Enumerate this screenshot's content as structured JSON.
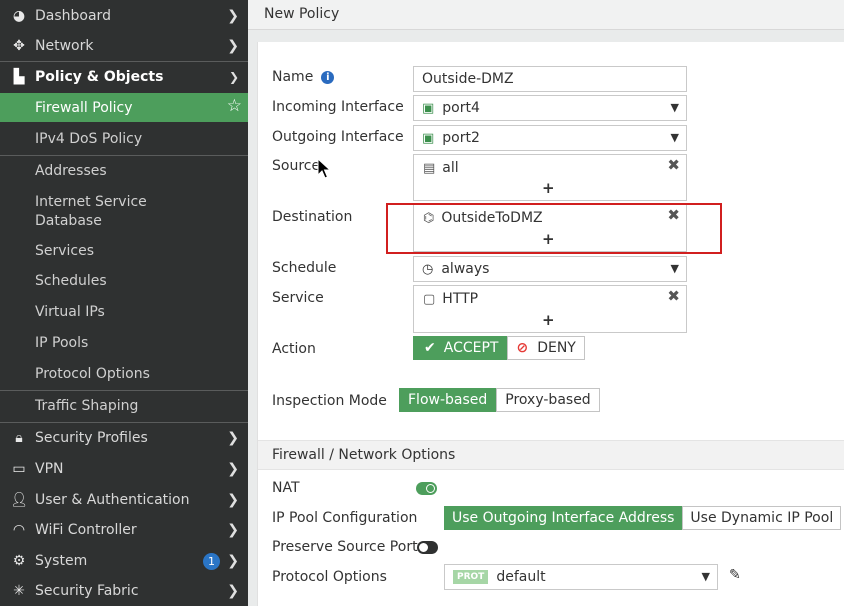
{
  "sidebar": {
    "items": [
      {
        "label": "Dashboard",
        "icon": "dashboard-icon"
      },
      {
        "label": "Network",
        "icon": "network-icon"
      },
      {
        "label": "Policy & Objects",
        "icon": "policy-icon"
      },
      {
        "label": "Security Profiles",
        "icon": "lock-icon"
      },
      {
        "label": "VPN",
        "icon": "laptop-icon"
      },
      {
        "label": "User & Authentication",
        "icon": "user-icon"
      },
      {
        "label": "WiFi Controller",
        "icon": "wifi-icon"
      },
      {
        "label": "System",
        "icon": "gear-icon",
        "badge": "1"
      },
      {
        "label": "Security Fabric",
        "icon": "fabric-icon"
      }
    ],
    "policy_sub": [
      {
        "label": "Firewall Policy",
        "active": true
      },
      {
        "label": "IPv4 DoS Policy"
      },
      {
        "label": "Addresses"
      },
      {
        "label": "Internet Service",
        "label2": "Database"
      },
      {
        "label": "Services"
      },
      {
        "label": "Schedules"
      },
      {
        "label": "Virtual IPs"
      },
      {
        "label": "IP Pools"
      },
      {
        "label": "Protocol Options"
      },
      {
        "label": "Traffic Shaping"
      }
    ]
  },
  "page": {
    "title": "New Policy"
  },
  "form": {
    "name_label": "Name",
    "name_value": "Outside-DMZ",
    "incoming_label": "Incoming Interface",
    "incoming_value": "port4",
    "outgoing_label": "Outgoing Interface",
    "outgoing_value": "port2",
    "source_label": "Source",
    "source_value": "all",
    "destination_label": "Destination",
    "destination_value": "OutsideToDMZ",
    "schedule_label": "Schedule",
    "schedule_value": "always",
    "service_label": "Service",
    "service_value": "HTTP",
    "action_label": "Action",
    "action_accept": "ACCEPT",
    "action_deny": "DENY",
    "inspection_label": "Inspection Mode",
    "inspection_flow": "Flow-based",
    "inspection_proxy": "Proxy-based",
    "add_symbol": "+",
    "remove_symbol": "✖"
  },
  "firewall_options": {
    "header": "Firewall / Network Options",
    "nat_label": "NAT",
    "nat_enabled": true,
    "ippool_label": "IP Pool Configuration",
    "ippool_outgoing": "Use Outgoing Interface Address",
    "ippool_dynamic": "Use Dynamic IP Pool",
    "preserve_label": "Preserve Source Port",
    "preserve_enabled": false,
    "protocol_label": "Protocol Options",
    "protocol_tag": "PROT",
    "protocol_value": "default"
  },
  "colors": {
    "accent_green": "#4d9e5c",
    "sidebar_bg": "#2f3131",
    "highlight_red": "#d11f1f",
    "badge_blue": "#2a75c6"
  }
}
